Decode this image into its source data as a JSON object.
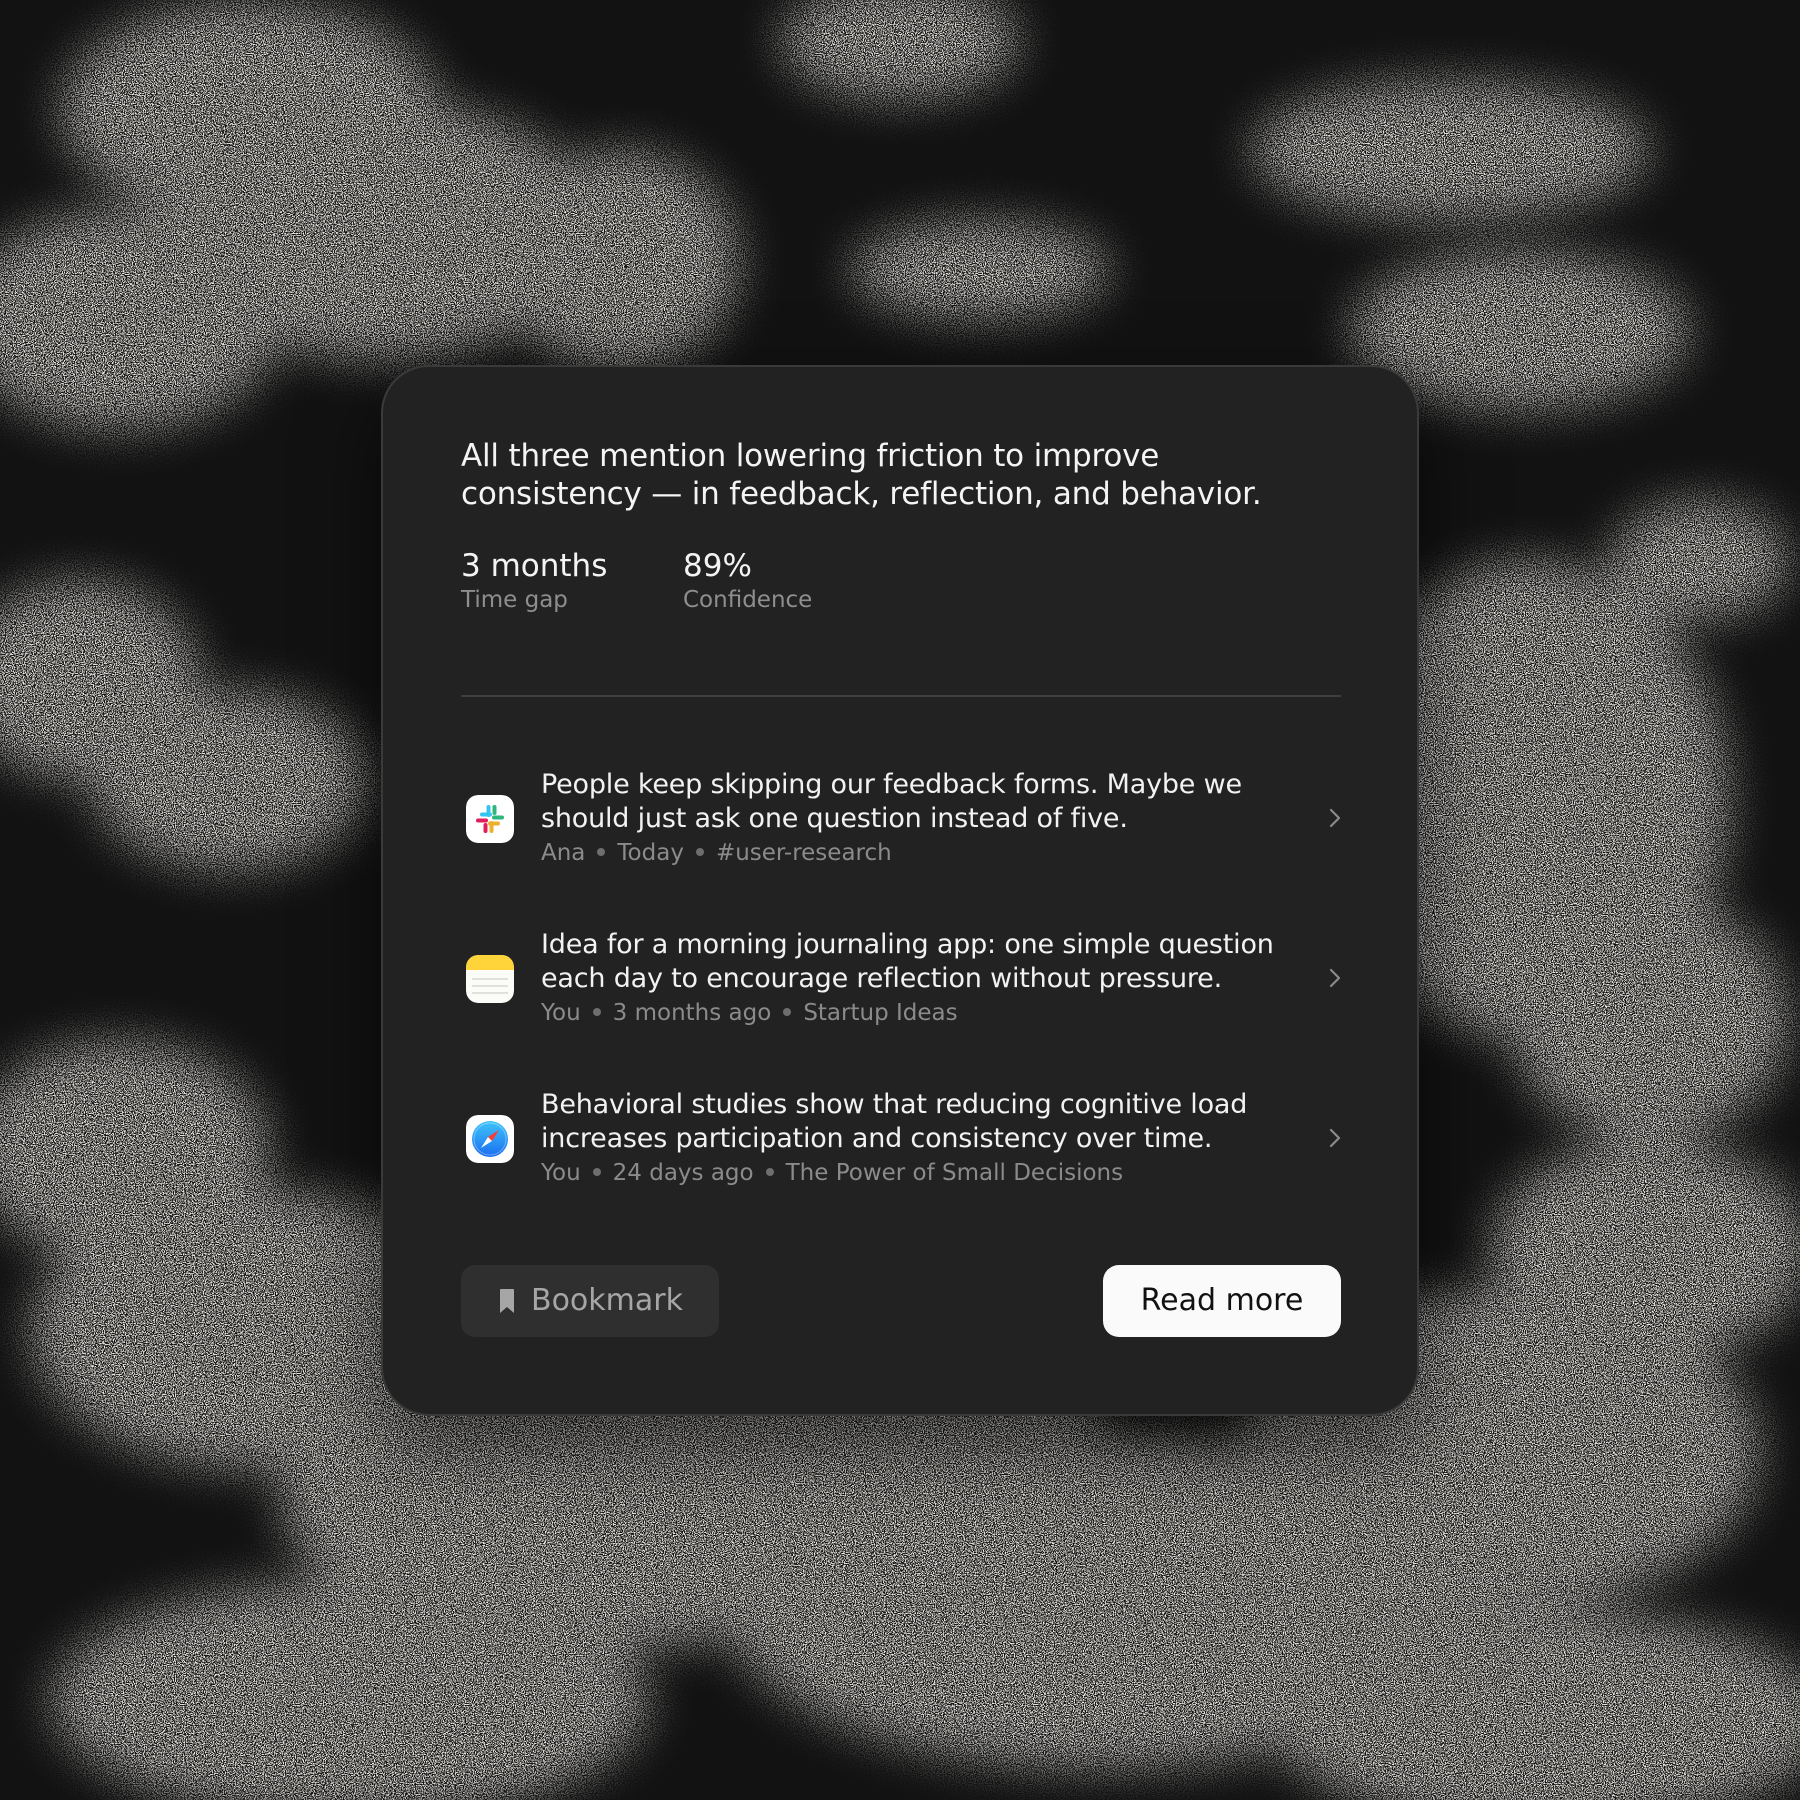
{
  "insight": {
    "headline": "All three mention lowering friction to improve consistency — in feedback, reflection, and behavior.",
    "stats": [
      {
        "value": "3 months",
        "label": "Time gap"
      },
      {
        "value": "89%",
        "label": "Confidence"
      }
    ]
  },
  "sources": [
    {
      "app_icon": "slack-icon",
      "text": "People keep skipping our feedback forms. Maybe we should just ask one question instead of five.",
      "author": "Ana",
      "time": "Today",
      "location": "#user-research"
    },
    {
      "app_icon": "notes-icon",
      "text": "Idea for a morning journaling app: one simple question each day to encourage reflection without pressure.",
      "author": "You",
      "time": "3 months ago",
      "location": "Startup Ideas"
    },
    {
      "app_icon": "safari-icon",
      "text": "Behavioral studies show that reducing cognitive load increases participation and consistency over time.",
      "author": "You",
      "time": "24 days ago",
      "location": "The Power of Small Decisions"
    }
  ],
  "actions": {
    "bookmark_label": "Bookmark",
    "read_more_label": "Read more"
  },
  "colors": {
    "page_background": "#121212",
    "card_background": "#222222",
    "primary_text": "#f2f2f2",
    "secondary_text": "#8b8b8b",
    "read_more_button": "#fafafa",
    "bookmark_button": "#2f2f2f"
  }
}
